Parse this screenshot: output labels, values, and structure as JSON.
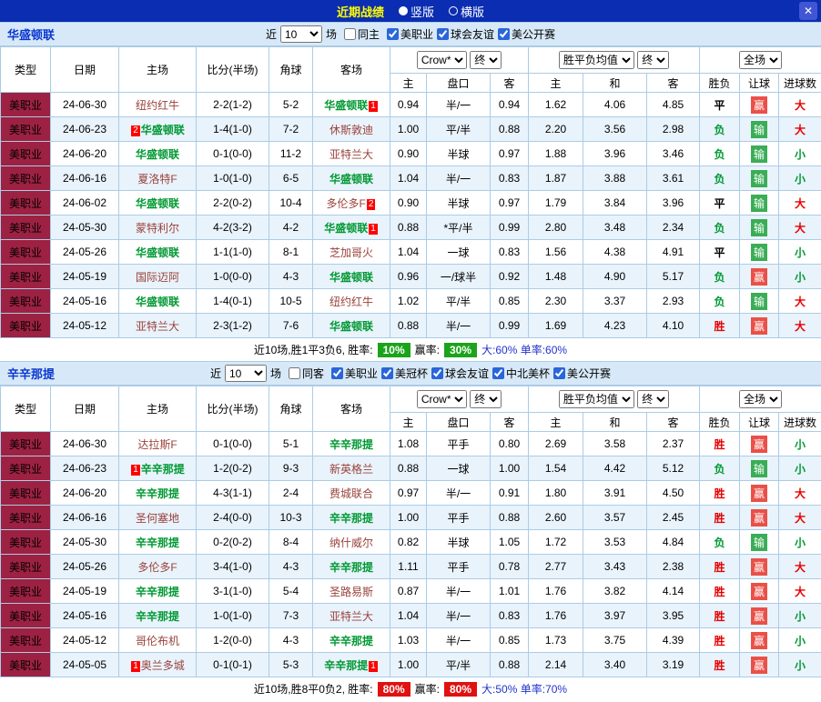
{
  "topbar": {
    "title": "近期战绩",
    "vertical": "竖版",
    "horizontal": "横版",
    "close": "✕"
  },
  "labels": {
    "near": "近",
    "matches": "场"
  },
  "headers": {
    "type": "类型",
    "date": "日期",
    "home": "主场",
    "score": "比分(半场)",
    "corner": "角球",
    "away": "客场",
    "bookmaker": "Crow*",
    "final": "终",
    "wdl_avg": "胜平负均值",
    "scope": "全场",
    "h": "主",
    "handicap": "盘口",
    "a": "客",
    "draw": "和",
    "result": "胜负",
    "let_ball": "让球",
    "goals": "进球数"
  },
  "colors": {
    "topbar_bg": "#0b2db1",
    "title_yellow": "#ffff00",
    "section_bg": "#d7e9f8",
    "team_link_blue": "#0a36cf",
    "border": "#abcce6",
    "stripe": "#e9f3fc",
    "league_bg": "#9d2142",
    "date_red": "#9c4440",
    "opponent": "#9a423b",
    "focus_team": "#009933",
    "score_red": "#ff0000",
    "handicap_blue": "#2633cc",
    "wdl_blue": "#3b72c3",
    "win": "#e60000",
    "draw": "#000000",
    "lose": "#009933",
    "hwin_bg": "#ea5048",
    "hlose_bg": "#3aad56",
    "big": "#e60000",
    "small": "#009933",
    "extra_blue": "#2233cc"
  },
  "sections": [
    {
      "team": "华盛顿联",
      "filter": {
        "count": "10",
        "same_label": "同主",
        "same_checked": false,
        "leagues": [
          {
            "label": "美职业",
            "checked": true
          },
          {
            "label": "球会友谊",
            "checked": true
          },
          {
            "label": "美公开赛",
            "checked": true
          }
        ]
      },
      "rows": [
        {
          "league": "美职业",
          "date": "24-06-30",
          "home": {
            "name": "纽约红牛",
            "focus": false
          },
          "score": "2-2(1-2)",
          "corner": "5-2",
          "away": {
            "name": "华盛顿联",
            "focus": true,
            "badge": "1",
            "badge_pos": "after"
          },
          "odds": [
            "0.94",
            "半/一",
            "0.94"
          ],
          "wdl": [
            "1.62",
            "4.06",
            "4.85"
          ],
          "result": "平",
          "let": "赢",
          "goals": "大"
        },
        {
          "league": "美职业",
          "date": "24-06-23",
          "home": {
            "name": "华盛顿联",
            "focus": true,
            "badge": "2",
            "badge_pos": "before"
          },
          "score": "1-4(1-0)",
          "corner": "7-2",
          "away": {
            "name": "休斯敦迪",
            "focus": false
          },
          "odds": [
            "1.00",
            "平/半",
            "0.88"
          ],
          "wdl": [
            "2.20",
            "3.56",
            "2.98"
          ],
          "result": "负",
          "let": "输",
          "goals": "大"
        },
        {
          "league": "美职业",
          "date": "24-06-20",
          "home": {
            "name": "华盛顿联",
            "focus": true
          },
          "score": "0-1(0-0)",
          "corner": "11-2",
          "away": {
            "name": "亚特兰大",
            "focus": false
          },
          "odds": [
            "0.90",
            "半球",
            "0.97"
          ],
          "wdl": [
            "1.88",
            "3.96",
            "3.46"
          ],
          "result": "负",
          "let": "输",
          "goals": "小"
        },
        {
          "league": "美职业",
          "date": "24-06-16",
          "home": {
            "name": "夏洛特F",
            "focus": false
          },
          "score": "1-0(1-0)",
          "corner": "6-5",
          "away": {
            "name": "华盛顿联",
            "focus": true
          },
          "odds": [
            "1.04",
            "半/一",
            "0.83"
          ],
          "wdl": [
            "1.87",
            "3.88",
            "3.61"
          ],
          "result": "负",
          "let": "输",
          "goals": "小"
        },
        {
          "league": "美职业",
          "date": "24-06-02",
          "home": {
            "name": "华盛顿联",
            "focus": true
          },
          "score": "2-2(0-2)",
          "corner": "10-4",
          "away": {
            "name": "多伦多F",
            "focus": false,
            "badge": "2",
            "badge_pos": "after"
          },
          "odds": [
            "0.90",
            "半球",
            "0.97"
          ],
          "wdl": [
            "1.79",
            "3.84",
            "3.96"
          ],
          "result": "平",
          "let": "输",
          "goals": "大"
        },
        {
          "league": "美职业",
          "date": "24-05-30",
          "home": {
            "name": "蒙特利尔",
            "focus": false
          },
          "score": "4-2(3-2)",
          "corner": "4-2",
          "away": {
            "name": "华盛顿联",
            "focus": true,
            "badge": "1",
            "badge_pos": "after"
          },
          "odds": [
            "0.88",
            "*平/半",
            "0.99"
          ],
          "wdl": [
            "2.80",
            "3.48",
            "2.34"
          ],
          "result": "负",
          "let": "输",
          "goals": "大"
        },
        {
          "league": "美职业",
          "date": "24-05-26",
          "home": {
            "name": "华盛顿联",
            "focus": true
          },
          "score": "1-1(1-0)",
          "corner": "8-1",
          "away": {
            "name": "芝加哥火",
            "focus": false
          },
          "odds": [
            "1.04",
            "一球",
            "0.83"
          ],
          "wdl": [
            "1.56",
            "4.38",
            "4.91"
          ],
          "result": "平",
          "let": "输",
          "goals": "小"
        },
        {
          "league": "美职业",
          "date": "24-05-19",
          "home": {
            "name": "国际迈阿",
            "focus": false
          },
          "score": "1-0(0-0)",
          "corner": "4-3",
          "away": {
            "name": "华盛顿联",
            "focus": true
          },
          "odds": [
            "0.96",
            "一/球半",
            "0.92"
          ],
          "wdl": [
            "1.48",
            "4.90",
            "5.17"
          ],
          "result": "负",
          "let": "赢",
          "goals": "小"
        },
        {
          "league": "美职业",
          "date": "24-05-16",
          "home": {
            "name": "华盛顿联",
            "focus": true
          },
          "score": "1-4(0-1)",
          "corner": "10-5",
          "away": {
            "name": "纽约红牛",
            "focus": false
          },
          "odds": [
            "1.02",
            "平/半",
            "0.85"
          ],
          "wdl": [
            "2.30",
            "3.37",
            "2.93"
          ],
          "result": "负",
          "let": "输",
          "goals": "大"
        },
        {
          "league": "美职业",
          "date": "24-05-12",
          "home": {
            "name": "亚特兰大",
            "focus": false
          },
          "score": "2-3(1-2)",
          "corner": "7-6",
          "away": {
            "name": "华盛顿联",
            "focus": true
          },
          "odds": [
            "0.88",
            "半/一",
            "0.99"
          ],
          "wdl": [
            "1.69",
            "4.23",
            "4.10"
          ],
          "result": "胜",
          "let": "赢",
          "goals": "大"
        }
      ],
      "footer": {
        "summary": "近10场,胜1平3负6, 胜率:",
        "win_rate": "10%",
        "profit_label": "赢率:",
        "profit_rate": "30%",
        "extra": "大:60% 单率:60%",
        "rate_bg": "#1ca31c"
      }
    },
    {
      "team": "辛辛那提",
      "filter": {
        "count": "10",
        "same_label": "同客",
        "same_checked": false,
        "leagues": [
          {
            "label": "美职业",
            "checked": true
          },
          {
            "label": "美冠杯",
            "checked": true
          },
          {
            "label": "球会友谊",
            "checked": true
          },
          {
            "label": "中北美杯",
            "checked": true
          },
          {
            "label": "美公开赛",
            "checked": true
          }
        ]
      },
      "rows": [
        {
          "league": "美职业",
          "date": "24-06-30",
          "home": {
            "name": "达拉斯F",
            "focus": false
          },
          "score": "0-1(0-0)",
          "corner": "5-1",
          "away": {
            "name": "辛辛那提",
            "focus": true
          },
          "odds": [
            "1.08",
            "平手",
            "0.80"
          ],
          "wdl": [
            "2.69",
            "3.58",
            "2.37"
          ],
          "result": "胜",
          "let": "赢",
          "goals": "小"
        },
        {
          "league": "美职业",
          "date": "24-06-23",
          "home": {
            "name": "辛辛那提",
            "focus": true,
            "badge": "1",
            "badge_pos": "before"
          },
          "score": "1-2(0-2)",
          "corner": "9-3",
          "away": {
            "name": "新英格兰",
            "focus": false
          },
          "odds": [
            "0.88",
            "一球",
            "1.00"
          ],
          "wdl": [
            "1.54",
            "4.42",
            "5.12"
          ],
          "result": "负",
          "let": "输",
          "goals": "小"
        },
        {
          "league": "美职业",
          "date": "24-06-20",
          "home": {
            "name": "辛辛那提",
            "focus": true
          },
          "score": "4-3(1-1)",
          "corner": "2-4",
          "away": {
            "name": "费城联合",
            "focus": false
          },
          "odds": [
            "0.97",
            "半/一",
            "0.91"
          ],
          "wdl": [
            "1.80",
            "3.91",
            "4.50"
          ],
          "result": "胜",
          "let": "赢",
          "goals": "大"
        },
        {
          "league": "美职业",
          "date": "24-06-16",
          "home": {
            "name": "圣何塞地",
            "focus": false
          },
          "score": "2-4(0-0)",
          "corner": "10-3",
          "away": {
            "name": "辛辛那提",
            "focus": true
          },
          "odds": [
            "1.00",
            "平手",
            "0.88"
          ],
          "wdl": [
            "2.60",
            "3.57",
            "2.45"
          ],
          "result": "胜",
          "let": "赢",
          "goals": "大"
        },
        {
          "league": "美职业",
          "date": "24-05-30",
          "home": {
            "name": "辛辛那提",
            "focus": true
          },
          "score": "0-2(0-2)",
          "corner": "8-4",
          "away": {
            "name": "纳什威尔",
            "focus": false
          },
          "odds": [
            "0.82",
            "半球",
            "1.05"
          ],
          "wdl": [
            "1.72",
            "3.53",
            "4.84"
          ],
          "result": "负",
          "let": "输",
          "goals": "小"
        },
        {
          "league": "美职业",
          "date": "24-05-26",
          "home": {
            "name": "多伦多F",
            "focus": false
          },
          "score": "3-4(1-0)",
          "corner": "4-3",
          "away": {
            "name": "辛辛那提",
            "focus": true
          },
          "odds": [
            "1.11",
            "平手",
            "0.78"
          ],
          "wdl": [
            "2.77",
            "3.43",
            "2.38"
          ],
          "result": "胜",
          "let": "赢",
          "goals": "大"
        },
        {
          "league": "美职业",
          "date": "24-05-19",
          "home": {
            "name": "辛辛那提",
            "focus": true
          },
          "score": "3-1(1-0)",
          "corner": "5-4",
          "away": {
            "name": "圣路易斯",
            "focus": false
          },
          "odds": [
            "0.87",
            "半/一",
            "1.01"
          ],
          "wdl": [
            "1.76",
            "3.82",
            "4.14"
          ],
          "result": "胜",
          "let": "赢",
          "goals": "大"
        },
        {
          "league": "美职业",
          "date": "24-05-16",
          "home": {
            "name": "辛辛那提",
            "focus": true
          },
          "score": "1-0(1-0)",
          "corner": "7-3",
          "away": {
            "name": "亚特兰大",
            "focus": false
          },
          "odds": [
            "1.04",
            "半/一",
            "0.83"
          ],
          "wdl": [
            "1.76",
            "3.97",
            "3.95"
          ],
          "result": "胜",
          "let": "赢",
          "goals": "小"
        },
        {
          "league": "美职业",
          "date": "24-05-12",
          "home": {
            "name": "哥伦布机",
            "focus": false
          },
          "score": "1-2(0-0)",
          "corner": "4-3",
          "away": {
            "name": "辛辛那提",
            "focus": true
          },
          "odds": [
            "1.03",
            "半/一",
            "0.85"
          ],
          "wdl": [
            "1.73",
            "3.75",
            "4.39"
          ],
          "result": "胜",
          "let": "赢",
          "goals": "小"
        },
        {
          "league": "美职业",
          "date": "24-05-05",
          "home": {
            "name": "奥兰多城",
            "focus": false,
            "badge": "1",
            "badge_pos": "before"
          },
          "score": "0-1(0-1)",
          "corner": "5-3",
          "away": {
            "name": "辛辛那提",
            "focus": true,
            "badge": "1",
            "badge_pos": "after"
          },
          "odds": [
            "1.00",
            "平/半",
            "0.88"
          ],
          "wdl": [
            "2.14",
            "3.40",
            "3.19"
          ],
          "result": "胜",
          "let": "赢",
          "goals": "小"
        }
      ],
      "footer": {
        "summary": "近10场,胜8平0负2, 胜率:",
        "win_rate": "80%",
        "profit_label": "赢率:",
        "profit_rate": "80%",
        "extra": "大:50% 单率:70%",
        "rate_bg": "#e01111"
      }
    }
  ]
}
